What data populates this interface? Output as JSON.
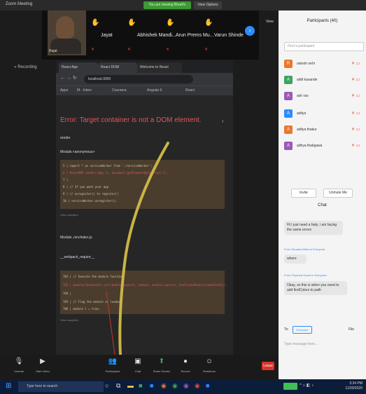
{
  "window": {
    "title": "Zoom Meeting",
    "share_pill": "You are viewing Bharti's screen",
    "view_options": "View Options"
  },
  "strip": {
    "self_name": "Rajat",
    "tiles": [
      {
        "name": "Jayat"
      },
      {
        "name": "Abhishek Mandi..."
      },
      {
        "name": "Arun Prems Mu..."
      },
      {
        "name": "Varun Shinde"
      }
    ],
    "view_label": "View"
  },
  "recording": {
    "label": "Recording"
  },
  "browser": {
    "tabs": [
      "React App",
      "React DOM",
      "Welcome to React"
    ],
    "url": "localhost:3000",
    "bookmarks": [
      "Apps",
      "M - Inbox",
      "Coursera",
      "Angular 6",
      "React"
    ],
    "error_title": "Error: Target container is not a DOM element.",
    "sections": [
      "render",
      "Module.<anonymous>",
      "Module../src/index.js",
      "__webpack_require__"
    ],
    "code1": [
      "  5 | import * as serviceWorker from './serviceWorker';",
      "  6 | ReactDOM.render(<App />, document.getElementById('root'));",
      "  7 | ",
      "  8 | // If you want your app",
      "  9 | // unregister() to register()",
      " 10 | serviceWorker.unregister();"
    ],
    "code2": [
      "782 | // Execute the module function",
      "783 | modules[moduleId].call(module.exports, module, module.exports, hotCreateRequire(moduleId));",
      "784 | ",
      "785 | // Flag the module as loaded",
      "786 | module.l = true;"
    ],
    "view_compiled": "View compiled"
  },
  "participants": {
    "title": "Participants (40)",
    "search_placeholder": "Find a participant",
    "list": [
      {
        "initial": "R",
        "name": "rakesh nehi",
        "color": "#e8772e"
      },
      {
        "initial": "A",
        "name": "aditi kasande",
        "color": "#3ba55d"
      },
      {
        "initial": "A",
        "name": "ash rao",
        "color": "#9b59b6"
      },
      {
        "initial": "A",
        "name": "aditya",
        "color": "#2d8cff"
      },
      {
        "initial": "A",
        "name": "aditya thakur",
        "color": "#e8772e"
      },
      {
        "initial": "A",
        "name": "adhya thakgawa",
        "color": "#9b59b6"
      }
    ],
    "invite": "Invite",
    "unmute": "Unmute Me"
  },
  "chat": {
    "title": "Chat",
    "messages": [
      {
        "from": "",
        "text": "Hi I just need a help, i am facing the same errors"
      },
      {
        "from": "From Shradha Mitra to Everyone:",
        "text": "where"
      },
      {
        "from": "From Priyanka Gupta to Everyone:",
        "text": "Okay, so this is when you need to add findColors to path"
      }
    ],
    "to_label": "To:",
    "to_value": "Everyone",
    "file_label": "File",
    "input_placeholder": "Type message here..."
  },
  "controls": {
    "items": [
      "Unmute",
      "Start Video",
      "Participants",
      "Chat",
      "Share Screen",
      "Record",
      "Reactions"
    ],
    "end": "Leave"
  },
  "taskbar": {
    "search": "Type here to search",
    "time": "3:34 PM",
    "date": "11/30/2020"
  }
}
